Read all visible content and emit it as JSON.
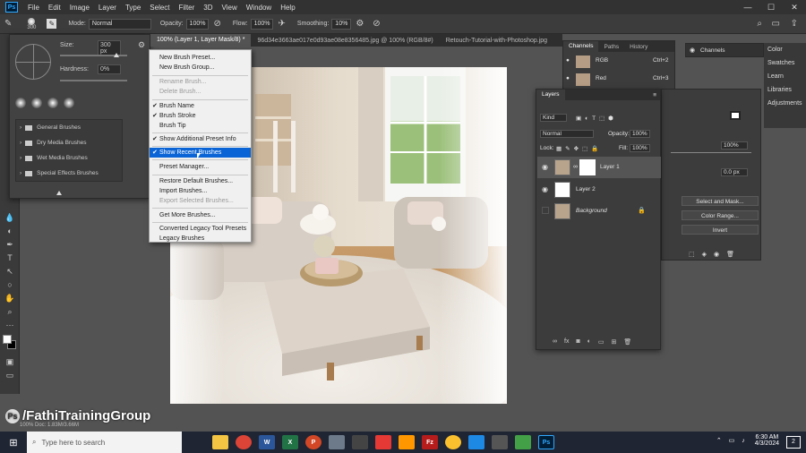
{
  "menubar": {
    "logo": "Ps",
    "items": [
      "File",
      "Edit",
      "Image",
      "Layer",
      "Type",
      "Select",
      "Filter",
      "3D",
      "View",
      "Window",
      "Help"
    ]
  },
  "window_controls": {
    "minimize": "—",
    "maximize": "☐",
    "close": "✕"
  },
  "options_bar": {
    "brush_size": "300",
    "mode_label": "Mode:",
    "mode_value": "Normal",
    "opacity_label": "Opacity:",
    "opacity_value": "100%",
    "flow_label": "Flow:",
    "flow_value": "100%",
    "smoothing_label": "Smoothing:",
    "smoothing_value": "10%"
  },
  "brush_panel": {
    "size_label": "Size:",
    "size_value": "300 px",
    "hardness_label": "Hardness:",
    "hardness_value": "0%",
    "folders": [
      "General Brushes",
      "Dry Media Brushes",
      "Wet Media Brushes",
      "Special Effects Brushes"
    ]
  },
  "document_tabs": [
    "100% (Layer 1, Layer Mask/8) *",
    "96d34e3663ae017e0d93ae08e8356485.jpg @ 100% (RGB/8#)",
    "Retouch-Tutorial-with-Photoshop.jpg"
  ],
  "dropdown": {
    "items": [
      {
        "label": "New Brush Preset...",
        "disabled": false,
        "checked": false,
        "highlighted": false
      },
      {
        "label": "New Brush Group...",
        "disabled": false,
        "checked": false,
        "highlighted": false
      },
      {
        "label": "Rename Brush...",
        "disabled": true,
        "checked": false,
        "highlighted": false
      },
      {
        "label": "Delete Brush...",
        "disabled": true,
        "checked": false,
        "highlighted": false
      },
      {
        "label": "Brush Name",
        "disabled": false,
        "checked": true,
        "highlighted": false
      },
      {
        "label": "Brush Stroke",
        "disabled": false,
        "checked": true,
        "highlighted": false
      },
      {
        "label": "Brush Tip",
        "disabled": false,
        "checked": false,
        "highlighted": false
      },
      {
        "label": "Show Additional Preset Info",
        "disabled": false,
        "checked": true,
        "highlighted": false
      },
      {
        "label": "Show Recent Brushes",
        "disabled": false,
        "checked": true,
        "highlighted": true
      },
      {
        "label": "Preset Manager...",
        "disabled": false,
        "checked": false,
        "highlighted": false
      },
      {
        "label": "Restore Default Brushes...",
        "disabled": false,
        "checked": false,
        "highlighted": false
      },
      {
        "label": "Import Brushes...",
        "disabled": false,
        "checked": false,
        "highlighted": false
      },
      {
        "label": "Export Selected Brushes...",
        "disabled": true,
        "checked": false,
        "highlighted": false
      },
      {
        "label": "Get More Brushes...",
        "disabled": false,
        "checked": false,
        "highlighted": false
      },
      {
        "label": "Converted Legacy Tool Presets",
        "disabled": false,
        "checked": false,
        "highlighted": false
      },
      {
        "label": "Legacy Brushes",
        "disabled": false,
        "checked": false,
        "highlighted": false
      }
    ]
  },
  "channels_panel": {
    "tabs": [
      "Channels",
      "Paths",
      "History"
    ],
    "rows": [
      {
        "name": "RGB",
        "shortcut": "Ctrl+2"
      },
      {
        "name": "Red",
        "shortcut": "Ctrl+3"
      }
    ]
  },
  "layers_panel": {
    "title": "Layers",
    "kind_label": "Kind",
    "blend_mode": "Normal",
    "opacity_label": "Opacity:",
    "opacity_value": "100%",
    "lock_label": "Lock:",
    "fill_label": "Fill:",
    "fill_value": "100%",
    "layers": [
      {
        "name": "Layer 1",
        "visible": true,
        "selected": true
      },
      {
        "name": "Layer 2",
        "visible": true,
        "selected": false
      },
      {
        "name": "Background",
        "visible": false,
        "selected": false
      }
    ]
  },
  "properties_panel": {
    "value1": "100%",
    "value2": "0.0 px",
    "buttons": [
      "Select and Mask...",
      "Color Range...",
      "Invert"
    ]
  },
  "right_dock": {
    "tab": "Channels",
    "items": [
      "Color",
      "Swatches",
      "Learn",
      "Libraries",
      "Adjustments"
    ]
  },
  "status_bar": "100%   Doc: 1.83M/3.66M",
  "watermark": "/FathiTrainingGroup",
  "taskbar": {
    "search_placeholder": "Type here to search",
    "time": "6:30 AM",
    "date": "4/3/2024",
    "notif_count": "2"
  }
}
